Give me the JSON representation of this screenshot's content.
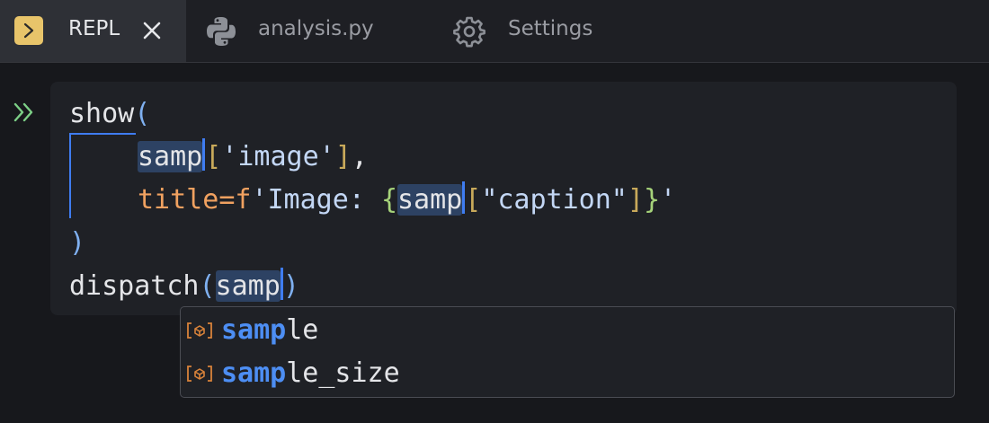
{
  "tabs": [
    {
      "label": "REPL",
      "icon": "repl-icon",
      "active": true,
      "closable": true
    },
    {
      "label": "analysis.py",
      "icon": "python-icon",
      "active": false
    },
    {
      "label": "Settings",
      "icon": "gear-icon",
      "active": false
    }
  ],
  "editor": {
    "prompt_glyph": "»",
    "lines": {
      "l1_fn": "show",
      "l1_paren": "(",
      "l2_word": "samp",
      "l2_open": "[",
      "l2_str": "'image'",
      "l2_close": "]",
      "l2_comma": ",",
      "l3_kw": "title",
      "l3_eq": "=",
      "l3_f": "f",
      "l3_str_a": "'Image: ",
      "l3_lbrace": "{",
      "l3_word": "samp",
      "l3_open": "[",
      "l3_str_b": "\"caption\"",
      "l3_close": "]",
      "l3_rbrace": "}",
      "l3_str_end": "'",
      "l4_paren": ")",
      "l5_fn": "dispatch",
      "l5_open": "(",
      "l5_word": "samp",
      "l5_close": ")"
    }
  },
  "autocomplete": {
    "items": [
      {
        "match": "samp",
        "rest": "le",
        "icon": "variable-icon"
      },
      {
        "match": "samp",
        "rest": "le_size",
        "icon": "variable-icon"
      }
    ]
  },
  "colors": {
    "accent": "#3f7cf0",
    "match": "#4d8ef3",
    "keyword_arg": "#f0a160",
    "repl_icon": "#e8c46a",
    "prompt": "#7ccf86"
  }
}
